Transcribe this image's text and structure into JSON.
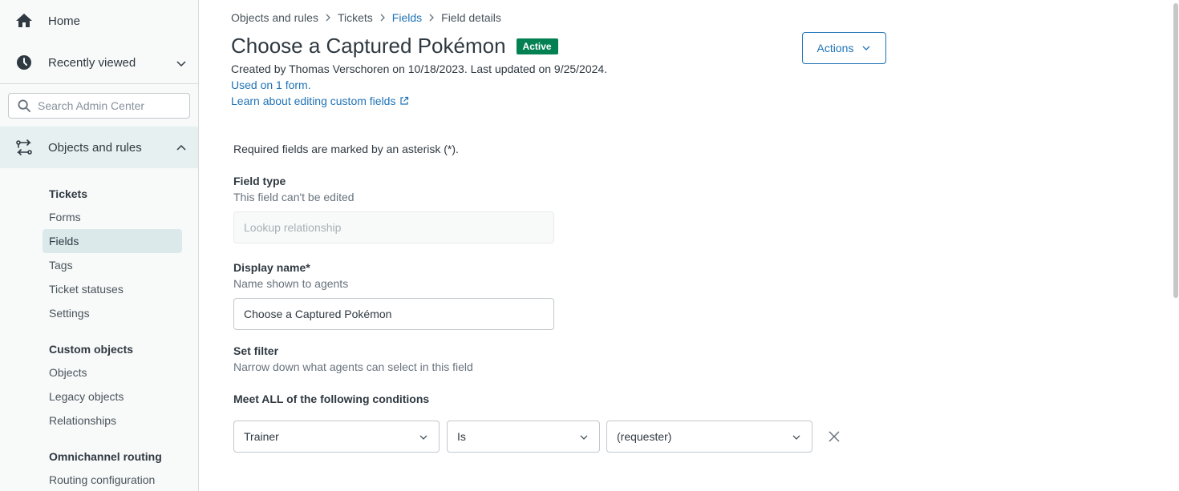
{
  "sidebar": {
    "home": "Home",
    "recently_viewed": "Recently viewed",
    "search_placeholder": "Search Admin Center",
    "objects_and_rules": "Objects and rules",
    "groups": [
      {
        "heading": "Tickets",
        "items": [
          "Forms",
          "Fields",
          "Tags",
          "Ticket statuses",
          "Settings"
        ],
        "selected": "Fields"
      },
      {
        "heading": "Custom objects",
        "items": [
          "Objects",
          "Legacy objects",
          "Relationships"
        ]
      },
      {
        "heading": "Omnichannel routing",
        "items": [
          "Routing configuration"
        ]
      }
    ]
  },
  "breadcrumb": [
    "Objects and rules",
    "Tickets",
    "Fields",
    "Field details"
  ],
  "header": {
    "title": "Choose a Captured Pokémon",
    "status": "Active",
    "meta": "Created by Thomas Verschoren on 10/18/2023. Last updated on 9/25/2024.",
    "used_on": "Used on 1 form.",
    "learn_link": "Learn about editing custom fields",
    "actions_label": "Actions"
  },
  "form": {
    "required_note": "Required fields are marked by an asterisk (*).",
    "field_type": {
      "label": "Field type",
      "hint": "This field can't be edited",
      "placeholder": "Lookup relationship"
    },
    "display_name": {
      "label": "Display name*",
      "hint": "Name shown to agents",
      "value": "Choose a Captured Pokémon"
    },
    "set_filter": {
      "label": "Set filter",
      "hint": "Narrow down what agents can select in this field"
    },
    "conditions_heading": "Meet ALL of the following conditions",
    "condition": {
      "field": "Trainer",
      "operator": "Is",
      "value": "(requester)"
    }
  },
  "colors": {
    "link": "#1f73b7",
    "active_badge": "#038153",
    "selected_nav": "#dbe9eb"
  }
}
